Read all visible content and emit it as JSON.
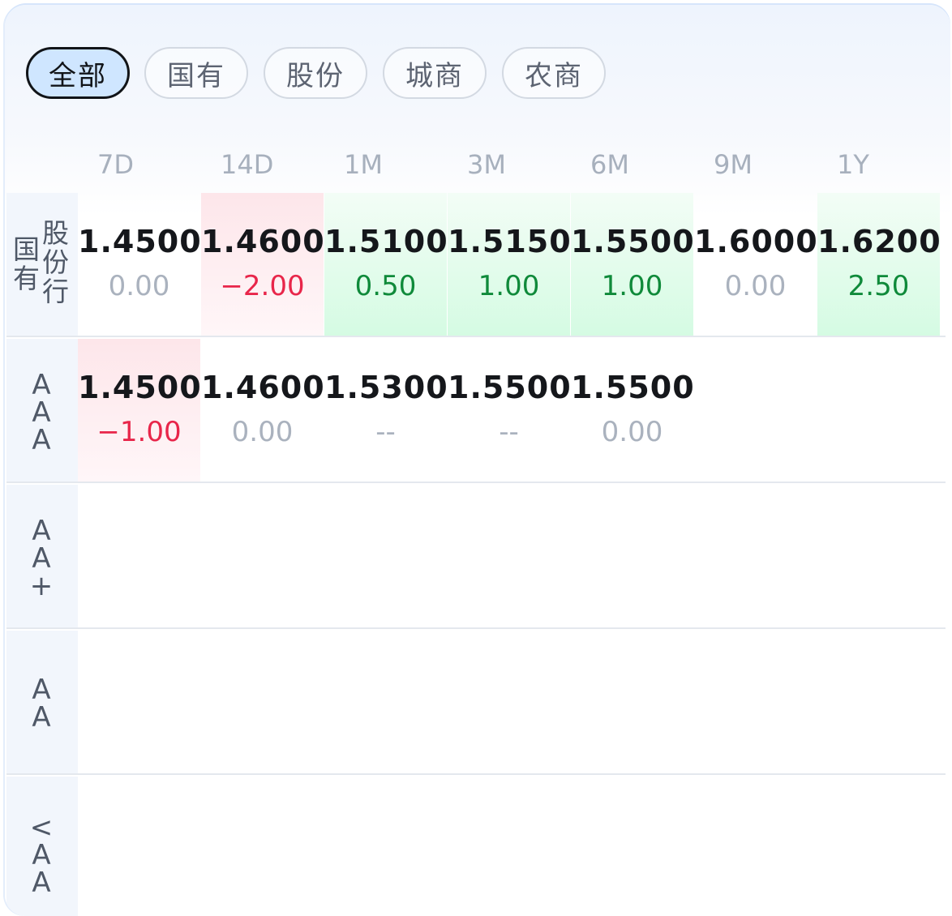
{
  "tabs": [
    {
      "label": "全部",
      "active": true
    },
    {
      "label": "国有",
      "active": false
    },
    {
      "label": "股份",
      "active": false
    },
    {
      "label": "城商",
      "active": false
    },
    {
      "label": "农商",
      "active": false
    }
  ],
  "columns": [
    "7D",
    "14D",
    "1M",
    "3M",
    "6M",
    "9M",
    "1Y"
  ],
  "rows": [
    {
      "label_left": "国\n有",
      "label_right": "股\n份\n行",
      "cells": [
        {
          "rate": "1.4500",
          "change": "0.00",
          "trend": "flat"
        },
        {
          "rate": "1.4600",
          "change": "−2.00",
          "trend": "down"
        },
        {
          "rate": "1.5100",
          "change": "0.50",
          "trend": "up"
        },
        {
          "rate": "1.5150",
          "change": "1.00",
          "trend": "up"
        },
        {
          "rate": "1.5500",
          "change": "1.00",
          "trend": "up"
        },
        {
          "rate": "1.6000",
          "change": "0.00",
          "trend": "flat"
        },
        {
          "rate": "1.6200",
          "change": "2.50",
          "trend": "up"
        }
      ]
    },
    {
      "label": "A\nA\nA",
      "cells": [
        {
          "rate": "1.4500",
          "change": "−1.00",
          "trend": "down"
        },
        {
          "rate": "1.4600",
          "change": "0.00",
          "trend": "flat"
        },
        {
          "rate": "1.5300",
          "change": "--",
          "trend": "flat"
        },
        {
          "rate": "1.5500",
          "change": "--",
          "trend": "flat"
        },
        {
          "rate": "1.5500",
          "change": "0.00",
          "trend": "flat"
        }
      ]
    },
    {
      "label": "A\nA\n+",
      "cells": []
    },
    {
      "label": "A\nA",
      "cells": []
    },
    {
      "label": "<\nA\nA",
      "cells": []
    }
  ],
  "colors": {
    "up": "#0f8a3a",
    "down": "#e8264a",
    "flat": "#aab2be",
    "active_tab_bg": "#cfe6ff"
  }
}
